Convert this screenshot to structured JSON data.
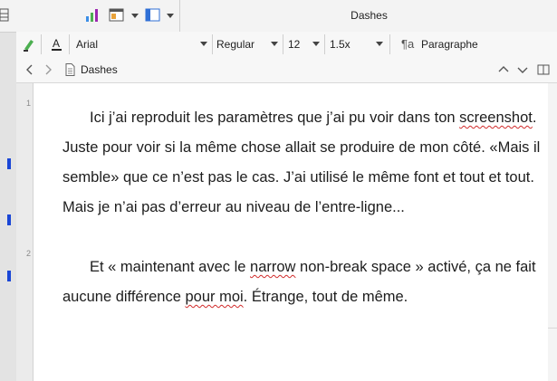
{
  "toolbar": {
    "icons": [
      "chart-icon",
      "layout-icon",
      "sidebar-toggle-icon"
    ],
    "document_title": "Dashes"
  },
  "format_bar": {
    "font_name": "Arial",
    "font_style": "Regular",
    "font_size": "12",
    "line_spacing": "1.5x",
    "paragraph_style": "Paragraphe"
  },
  "document_header": {
    "title": "Dashes"
  },
  "editor": {
    "line_numbers": [
      "1",
      "2"
    ],
    "paragraphs": [
      {
        "before": "Ici j’ai reproduit les paramètres que j’ai pu voir dans ton ",
        "flagged": "screenshot",
        "after": ". Juste pour voir si la même chose allait se produire de mon côté. «Mais il semble» que ce n’est pas le cas. J’ai utilisé le même font et tout et tout. Mais je n’ai pas d’erreur au niveau de l’entre-ligne..."
      },
      {
        "before": "Et « maintenant avec le ",
        "flagged": "narrow",
        "middle": " non-break space » activé, ça ne fait aucune différence ",
        "flagged2": "pour moi",
        "after": ". Étrange, tout de même."
      }
    ]
  },
  "colors": {
    "spellcheck": "#d12b2b",
    "accent_blue": "#1a46d6"
  }
}
